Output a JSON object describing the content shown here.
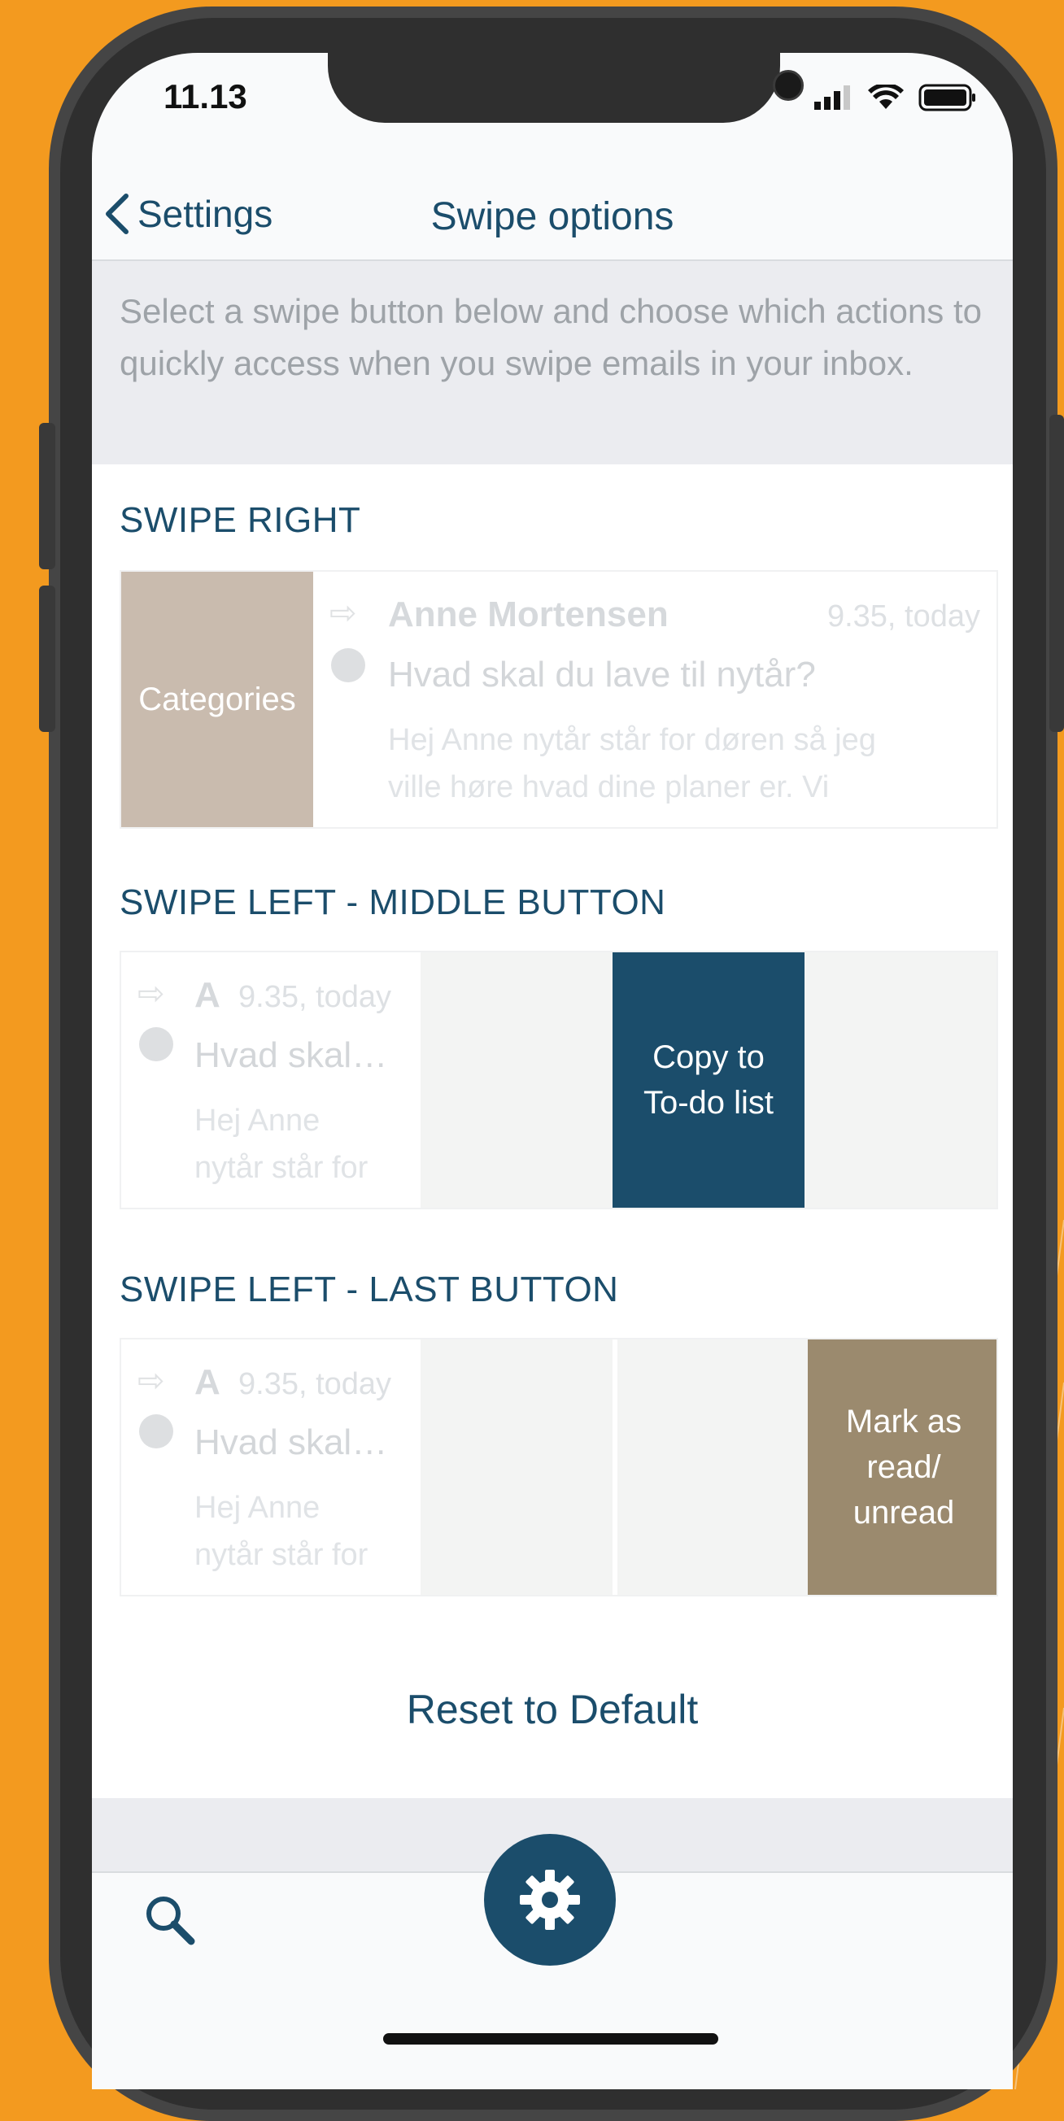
{
  "status": {
    "time": "11.13"
  },
  "nav": {
    "back_label": "Settings",
    "title": "Swipe options"
  },
  "intro": "Select a swipe button below and choose which actions to quickly access when you swipe emails in your inbox.",
  "sections": {
    "right": {
      "title": "SWIPE RIGHT",
      "action_label": "Categories",
      "action_color": "#C9BBAE",
      "email": {
        "sender": "Anne Mortensen",
        "time": "9.35, today",
        "subject": "Hvad skal du lave til nytår?",
        "preview_line1": "Hej Anne nytår står for døren så jeg",
        "preview_line2": "ville høre hvad dine planer er. Vi"
      }
    },
    "left_middle": {
      "title": "SWIPE LEFT - MIDDLE BUTTON",
      "action_label_line1": "Copy to",
      "action_label_line2": "To-do list",
      "action_color": "#1B4D6B",
      "email": {
        "sender": "A",
        "time": "9.35, today",
        "subject": "Hvad skal…",
        "preview_line1": "Hej Anne",
        "preview_line2": "nytår står for"
      }
    },
    "left_last": {
      "title": "SWIPE LEFT - LAST BUTTON",
      "action_label_line1": "Mark as",
      "action_label_line2": "read/",
      "action_label_line3": "unread",
      "action_color": "#9B8A6E",
      "email": {
        "sender": "A",
        "time": "9.35, today",
        "subject": "Hvad skal…",
        "preview_line1": "Hej Anne",
        "preview_line2": "nytår står for"
      }
    }
  },
  "reset_label": "Reset to Default",
  "tabbar": {
    "search_icon": "search-icon",
    "settings_icon": "gear-icon"
  },
  "colors": {
    "accent": "#1B4D6B",
    "background": "#F39A1F"
  }
}
